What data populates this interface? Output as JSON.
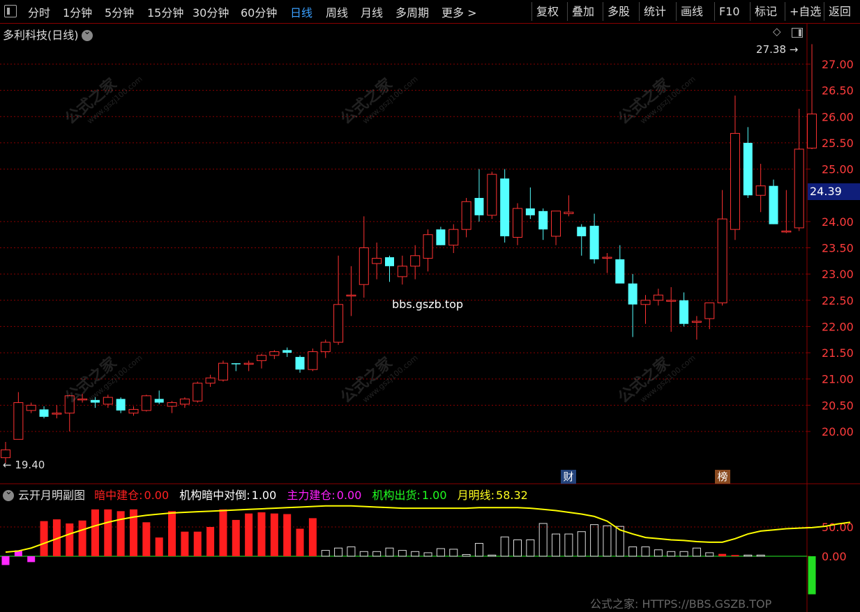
{
  "toolbar": {
    "menu_icon": "panel-toggle-icon",
    "periods": [
      "分时",
      "1分钟",
      "5分钟",
      "15分钟",
      "30分钟",
      "60分钟",
      "日线",
      "周线",
      "月线",
      "多周期",
      "更多 >"
    ],
    "active_period": "日线",
    "right_buttons": [
      "复权",
      "叠加",
      "多股",
      "统计",
      "画线",
      "F10",
      "标记",
      "+自选",
      "返回"
    ]
  },
  "stock": {
    "title": "多利科技(日线)"
  },
  "price_axis": {
    "labels": [
      "27.00",
      "26.50",
      "26.00",
      "25.50",
      "25.00",
      "24.00",
      "23.50",
      "23.00",
      "22.50",
      "22.00",
      "21.50",
      "21.00",
      "20.50",
      "20.00"
    ],
    "current_price": "24.39",
    "high_label": "27.38",
    "low_label": "19.40"
  },
  "markers": {
    "finance": "财",
    "rank": "榜"
  },
  "center_text": "bbs.gszb.top",
  "watermark": {
    "cn": "公式之家",
    "en": "www.gszj100.com"
  },
  "indicator": {
    "name": "云开月明副图",
    "items": [
      {
        "label": "暗中建仓:",
        "value": "0.00",
        "color": "#ff2020"
      },
      {
        "label": "机构暗中对倒:",
        "value": "1.00",
        "color": "#ffffff"
      },
      {
        "label": "主力建仓:",
        "value": "0.00",
        "color": "#ff20ff"
      },
      {
        "label": "机构出货:",
        "value": "1.00",
        "color": "#20ff20"
      },
      {
        "label": "月明线:",
        "value": "58.32",
        "color": "#ffff20"
      }
    ],
    "axis_labels": [
      "50.00",
      "0.00"
    ]
  },
  "footer": "公式之家: HTTPS://BBS.GSZB.TOP",
  "chart_data": {
    "type": "candlestick",
    "ylim": [
      19.4,
      27.38
    ],
    "candles": [
      {
        "o": 19.5,
        "h": 19.8,
        "l": 19.4,
        "c": 19.65
      },
      {
        "o": 19.85,
        "h": 20.75,
        "l": 19.85,
        "c": 20.55
      },
      {
        "o": 20.4,
        "h": 20.55,
        "l": 20.35,
        "c": 20.5
      },
      {
        "o": 20.42,
        "h": 20.48,
        "l": 20.25,
        "c": 20.28
      },
      {
        "o": 20.35,
        "h": 20.5,
        "l": 20.25,
        "c": 20.35
      },
      {
        "o": 20.35,
        "h": 20.7,
        "l": 20.0,
        "c": 20.68
      },
      {
        "o": 20.6,
        "h": 20.72,
        "l": 20.55,
        "c": 20.62
      },
      {
        "o": 20.6,
        "h": 20.65,
        "l": 20.45,
        "c": 20.55
      },
      {
        "o": 20.52,
        "h": 20.7,
        "l": 20.45,
        "c": 20.65
      },
      {
        "o": 20.62,
        "h": 20.65,
        "l": 20.35,
        "c": 20.4
      },
      {
        "o": 20.35,
        "h": 20.48,
        "l": 20.3,
        "c": 20.42
      },
      {
        "o": 20.4,
        "h": 20.7,
        "l": 20.38,
        "c": 20.68
      },
      {
        "o": 20.62,
        "h": 20.78,
        "l": 20.52,
        "c": 20.55
      },
      {
        "o": 20.48,
        "h": 20.58,
        "l": 20.35,
        "c": 20.55
      },
      {
        "o": 20.52,
        "h": 20.65,
        "l": 20.45,
        "c": 20.62
      },
      {
        "o": 20.58,
        "h": 20.95,
        "l": 20.55,
        "c": 20.92
      },
      {
        "o": 20.92,
        "h": 21.08,
        "l": 20.85,
        "c": 21.02
      },
      {
        "o": 20.98,
        "h": 21.35,
        "l": 20.95,
        "c": 21.3
      },
      {
        "o": 21.3,
        "h": 21.3,
        "l": 21.15,
        "c": 21.28
      },
      {
        "o": 21.28,
        "h": 21.35,
        "l": 21.15,
        "c": 21.3
      },
      {
        "o": 21.35,
        "h": 21.48,
        "l": 21.2,
        "c": 21.45
      },
      {
        "o": 21.45,
        "h": 21.55,
        "l": 21.38,
        "c": 21.52
      },
      {
        "o": 21.55,
        "h": 21.6,
        "l": 21.42,
        "c": 21.5
      },
      {
        "o": 21.42,
        "h": 21.45,
        "l": 21.12,
        "c": 21.18
      },
      {
        "o": 21.18,
        "h": 21.58,
        "l": 21.15,
        "c": 21.52
      },
      {
        "o": 21.52,
        "h": 21.75,
        "l": 21.4,
        "c": 21.7
      },
      {
        "o": 21.7,
        "h": 23.35,
        "l": 21.65,
        "c": 22.42
      },
      {
        "o": 22.6,
        "h": 23.15,
        "l": 22.2,
        "c": 22.6
      },
      {
        "o": 22.8,
        "h": 24.1,
        "l": 22.55,
        "c": 23.5
      },
      {
        "o": 23.2,
        "h": 23.6,
        "l": 22.9,
        "c": 23.3
      },
      {
        "o": 23.32,
        "h": 23.35,
        "l": 22.85,
        "c": 23.15
      },
      {
        "o": 22.95,
        "h": 23.35,
        "l": 22.8,
        "c": 23.15
      },
      {
        "o": 23.15,
        "h": 23.55,
        "l": 22.9,
        "c": 23.35
      },
      {
        "o": 23.3,
        "h": 23.85,
        "l": 23.05,
        "c": 23.75
      },
      {
        "o": 23.85,
        "h": 23.9,
        "l": 23.55,
        "c": 23.55
      },
      {
        "o": 23.55,
        "h": 23.95,
        "l": 23.4,
        "c": 23.85
      },
      {
        "o": 23.85,
        "h": 24.45,
        "l": 23.7,
        "c": 24.38
      },
      {
        "o": 24.45,
        "h": 25.0,
        "l": 24.0,
        "c": 24.12
      },
      {
        "o": 24.12,
        "h": 24.95,
        "l": 24.05,
        "c": 24.9
      },
      {
        "o": 24.82,
        "h": 25.0,
        "l": 23.6,
        "c": 23.72
      },
      {
        "o": 23.7,
        "h": 24.35,
        "l": 23.55,
        "c": 24.25
      },
      {
        "o": 24.25,
        "h": 24.65,
        "l": 24.05,
        "c": 24.12
      },
      {
        "o": 24.2,
        "h": 24.25,
        "l": 23.65,
        "c": 23.85
      },
      {
        "o": 23.72,
        "h": 24.2,
        "l": 23.55,
        "c": 24.2
      },
      {
        "o": 24.15,
        "h": 24.5,
        "l": 24.1,
        "c": 24.18
      },
      {
        "o": 23.9,
        "h": 23.95,
        "l": 23.35,
        "c": 23.72
      },
      {
        "o": 23.92,
        "h": 24.15,
        "l": 23.2,
        "c": 23.28
      },
      {
        "o": 23.3,
        "h": 23.4,
        "l": 23.02,
        "c": 23.32
      },
      {
        "o": 23.28,
        "h": 23.55,
        "l": 22.85,
        "c": 22.82
      },
      {
        "o": 22.82,
        "h": 23.0,
        "l": 21.8,
        "c": 22.42
      },
      {
        "o": 22.42,
        "h": 22.6,
        "l": 22.05,
        "c": 22.5
      },
      {
        "o": 22.5,
        "h": 22.72,
        "l": 22.4,
        "c": 22.6
      },
      {
        "o": 22.5,
        "h": 22.75,
        "l": 21.9,
        "c": 22.5
      },
      {
        "o": 22.5,
        "h": 22.65,
        "l": 22.0,
        "c": 22.05
      },
      {
        "o": 22.08,
        "h": 22.2,
        "l": 21.75,
        "c": 22.1
      },
      {
        "o": 22.15,
        "h": 22.45,
        "l": 21.95,
        "c": 22.45
      },
      {
        "o": 22.45,
        "h": 24.6,
        "l": 22.4,
        "c": 24.05
      },
      {
        "o": 23.85,
        "h": 26.4,
        "l": 23.65,
        "c": 25.68
      },
      {
        "o": 25.5,
        "h": 25.8,
        "l": 24.45,
        "c": 24.5
      },
      {
        "o": 24.5,
        "h": 25.1,
        "l": 24.18,
        "c": 24.68
      },
      {
        "o": 24.68,
        "h": 24.8,
        "l": 23.95,
        "c": 23.95
      },
      {
        "o": 23.82,
        "h": 24.6,
        "l": 23.78,
        "c": 23.82
      },
      {
        "o": 23.88,
        "h": 26.15,
        "l": 23.82,
        "c": 25.38
      },
      {
        "o": 25.4,
        "h": 27.38,
        "l": 25.38,
        "c": 26.05
      }
    ],
    "indicator_bars": [
      {
        "v": -15,
        "c": "magenta"
      },
      {
        "v": 10,
        "c": "magenta"
      },
      {
        "v": -10,
        "c": "magenta"
      },
      {
        "v": 60,
        "c": "red"
      },
      {
        "v": 63,
        "c": "red"
      },
      {
        "v": 56,
        "c": "red"
      },
      {
        "v": 61,
        "c": "red"
      },
      {
        "v": 80,
        "c": "red"
      },
      {
        "v": 80,
        "c": "red"
      },
      {
        "v": 77,
        "c": "red"
      },
      {
        "v": 80,
        "c": "red"
      },
      {
        "v": 58,
        "c": "red"
      },
      {
        "v": 32,
        "c": "red"
      },
      {
        "v": 77,
        "c": "red"
      },
      {
        "v": 42,
        "c": "red"
      },
      {
        "v": 42,
        "c": "red"
      },
      {
        "v": 50,
        "c": "red"
      },
      {
        "v": 80,
        "c": "red"
      },
      {
        "v": 62,
        "c": "red"
      },
      {
        "v": 73,
        "c": "red"
      },
      {
        "v": 75,
        "c": "red"
      },
      {
        "v": 73,
        "c": "red"
      },
      {
        "v": 72,
        "c": "red"
      },
      {
        "v": 47,
        "c": "red"
      },
      {
        "v": 65,
        "c": "red"
      },
      {
        "v": 10,
        "c": "white"
      },
      {
        "v": 14,
        "c": "white"
      },
      {
        "v": 16,
        "c": "white"
      },
      {
        "v": 8,
        "c": "white"
      },
      {
        "v": 8,
        "c": "white"
      },
      {
        "v": 14,
        "c": "white"
      },
      {
        "v": 10,
        "c": "white"
      },
      {
        "v": 8,
        "c": "white"
      },
      {
        "v": 6,
        "c": "white"
      },
      {
        "v": 13,
        "c": "white"
      },
      {
        "v": 12,
        "c": "white"
      },
      {
        "v": 3,
        "c": "white"
      },
      {
        "v": 22,
        "c": "white"
      },
      {
        "v": 2,
        "c": "white"
      },
      {
        "v": 33,
        "c": "white"
      },
      {
        "v": 28,
        "c": "white"
      },
      {
        "v": 28,
        "c": "white"
      },
      {
        "v": 56,
        "c": "white"
      },
      {
        "v": 38,
        "c": "white"
      },
      {
        "v": 38,
        "c": "white"
      },
      {
        "v": 42,
        "c": "white"
      },
      {
        "v": 54,
        "c": "white"
      },
      {
        "v": 52,
        "c": "white"
      },
      {
        "v": 51,
        "c": "white"
      },
      {
        "v": 16,
        "c": "white"
      },
      {
        "v": 16,
        "c": "white"
      },
      {
        "v": 11,
        "c": "white"
      },
      {
        "v": 8,
        "c": "white"
      },
      {
        "v": 8,
        "c": "white"
      },
      {
        "v": 14,
        "c": "white"
      },
      {
        "v": 6,
        "c": "white"
      },
      {
        "v": 4,
        "c": "red"
      },
      {
        "v": 2,
        "c": "red"
      },
      {
        "v": 2,
        "c": "white"
      },
      {
        "v": 2,
        "c": "white"
      },
      {
        "v": 0,
        "c": "white"
      },
      {
        "v": 0,
        "c": "white"
      },
      {
        "v": 0,
        "c": "white"
      },
      {
        "v": -65,
        "c": "green"
      }
    ],
    "moon_line": [
      7,
      9,
      14,
      22,
      30,
      38,
      45,
      52,
      58,
      63,
      67,
      70,
      72,
      74,
      75,
      76,
      77,
      78,
      79,
      80,
      81,
      82,
      83,
      84,
      85,
      86,
      86,
      86,
      85,
      84,
      83,
      82,
      82,
      82,
      82,
      82,
      82,
      83,
      83,
      83,
      83,
      82,
      80,
      78,
      75,
      72,
      68,
      60,
      45,
      38,
      32,
      30,
      28,
      27,
      25,
      24,
      24,
      30,
      38,
      43,
      45,
      47,
      48,
      49,
      51,
      55,
      58
    ],
    "colors": {
      "up": "#ff3232",
      "down": "#54ffff",
      "line": "#ffff00",
      "grid": "#8a0000"
    }
  }
}
